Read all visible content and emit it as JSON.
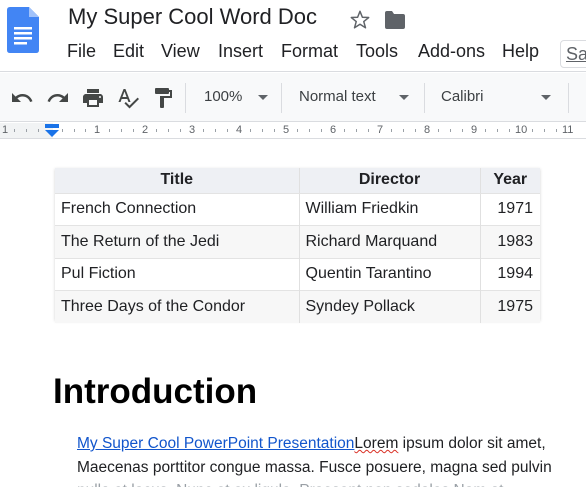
{
  "header": {
    "doc_title": "My Super Cool Word Doc",
    "menu": [
      "File",
      "Edit",
      "View",
      "Insert",
      "Format",
      "Tools",
      "Add-ons",
      "Help"
    ],
    "share_partial": "Sa"
  },
  "toolbar": {
    "zoom": "100%",
    "style": "Normal text",
    "font": "Calibri"
  },
  "ruler": {
    "numbers": [
      "1",
      "1",
      "2",
      "3",
      "4",
      "5",
      "6",
      "7",
      "8",
      "9",
      "10",
      "11"
    ]
  },
  "table": {
    "headers": [
      "Title",
      "Director",
      "Year"
    ],
    "rows": [
      [
        "French Connection",
        "William Friedkin",
        "1971"
      ],
      [
        "The Return of the Jedi",
        "Richard Marquand",
        "1983"
      ],
      [
        "Pul Fiction",
        "Quentin Tarantino",
        "1994"
      ],
      [
        "Three Days of the Condor",
        "Syndey Pollack",
        "1975"
      ]
    ]
  },
  "body": {
    "heading": "Introduction",
    "link_text": "My Super Cool PowerPoint Presentation",
    "line1_rest_a": "Lorem",
    "line1_rest_b": " ipsum dolor sit amet,",
    "line2": "Maecenas porttitor congue massa. Fusce posuere, magna sed pulvin",
    "line3": "nulla et lacus. Nunc et ex ligula. Praesent non sodales Nam at"
  },
  "colors": {
    "docs_blue": "#4285f4",
    "link": "#1155cc",
    "accent_marker": "#1a73e8"
  }
}
